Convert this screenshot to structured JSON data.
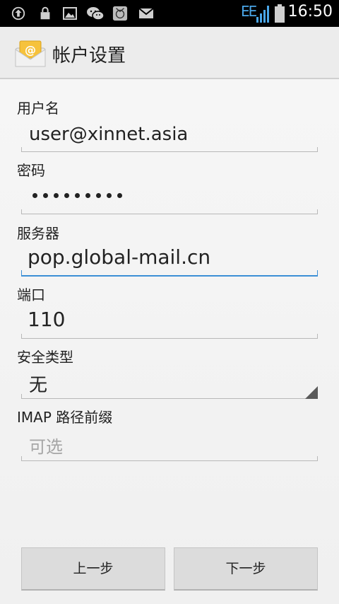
{
  "status_bar": {
    "network": "EE",
    "time": "16:50",
    "icons": [
      "upload-icon",
      "lock-icon",
      "image-icon",
      "wechat-icon",
      "app-icon",
      "mail-icon",
      "signal-icon",
      "battery-icon"
    ]
  },
  "app_bar": {
    "title": "帐户设置",
    "icon": "email-icon"
  },
  "form": {
    "username_label": "用户名",
    "username_value": "user@xinnet.asia",
    "password_label": "密码",
    "password_mask_count": 9,
    "server_label": "服务器",
    "server_value": "pop.global-mail.cn",
    "port_label": "端口",
    "port_value": "110",
    "security_label": "安全类型",
    "security_value": "无",
    "imap_prefix_label": "IMAP 路径前缀",
    "imap_prefix_placeholder": "可选"
  },
  "buttons": {
    "previous": "上一步",
    "next": "下一步"
  },
  "colors": {
    "status_bar": "#000000",
    "accent": "#3c8fd6",
    "network_accent": "#4aa6e8"
  }
}
